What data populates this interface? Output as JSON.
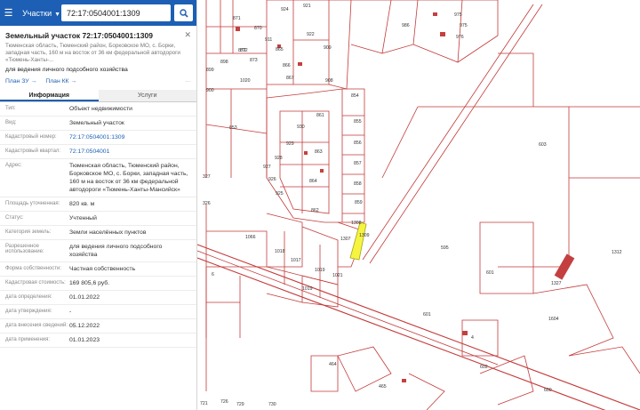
{
  "search": {
    "type_label": "Участки",
    "query": "72:17:0504001:1309"
  },
  "parcel": {
    "title": "Земельный участок 72:17:0504001:1309",
    "address_short": "Тюменская область, Тюменский район, Борковское МО, с. Борки, западная часть, 160 м на восток от 36 км федеральной автодороги «Тюмень-Ханты-...",
    "purpose": "для ведения личного подсобного хозяйства",
    "plan_zu": "План ЗУ →",
    "plan_kk": "План КК →",
    "more": "···"
  },
  "tabs": [
    {
      "label": "Информация"
    },
    {
      "label": "Услуги"
    }
  ],
  "info_rows": [
    {
      "key": "Тип:",
      "value": "Объект недвижимости"
    },
    {
      "key": "Вид:",
      "value": "Земельный участок"
    },
    {
      "key": "Кадастровый номер:",
      "value": "72:17:0504001:1309"
    },
    {
      "key": "Кадастровый квартал:",
      "value": "72:17:0504001"
    },
    {
      "key": "Адрес:",
      "value": "Тюменская область, Тюменский район, Борковское МО, с. Борки, западная часть, 160 м на восток от 36 км федеральной автодороги «Тюмень-Ханты-Мансийск»"
    },
    {
      "key": "Площадь уточненная:",
      "value": "820 кв. м"
    },
    {
      "key": "Статус:",
      "value": "Учтенный"
    },
    {
      "key": "Категория земель:",
      "value": "Земли населённых пунктов"
    },
    {
      "key": "Разрешенное использование:",
      "value": "для ведения личного подсобного хозяйства"
    },
    {
      "key": "Форма собственности:",
      "value": "Частная собственность"
    },
    {
      "key": "Кадастровая стоимость:",
      "value": "169 805,6 руб."
    },
    {
      "key": "дата определения:",
      "value": "01.01.2022"
    },
    {
      "key": "дата утверждения:",
      "value": "-"
    },
    {
      "key": "дата внесения сведений:",
      "value": "05.12.2022"
    },
    {
      "key": "дата применения:",
      "value": "01.01.2023"
    }
  ],
  "map": {
    "parcel_labels": [
      "924",
      "921",
      "975",
      "986",
      "871",
      "870",
      "911",
      "865",
      "922",
      "975",
      "976",
      "872",
      "873",
      "866",
      "909",
      "898",
      "872",
      "899",
      "1020",
      "900",
      "908",
      "867",
      "854",
      "853",
      "930",
      "861",
      "855",
      "929",
      "856",
      "863",
      "857",
      "928",
      "927",
      "858",
      "926",
      "864",
      "859",
      "925",
      "862",
      "1308",
      "1307",
      "1066",
      "1018",
      "1017",
      "1019",
      "1021",
      "1019",
      "1309",
      "603",
      "595",
      "601",
      "601",
      "600",
      "602",
      "465",
      "464",
      "327",
      "326",
      "721",
      "1312",
      "1327",
      "1604",
      "6",
      "4",
      "726",
      "729",
      "730"
    ],
    "highlight_label": "1309"
  },
  "colors": {
    "brand": "#1d5fb4",
    "parcel_line": "#c43a3a",
    "highlight_fill": "#f5f541",
    "building_fill": "#c44040"
  }
}
